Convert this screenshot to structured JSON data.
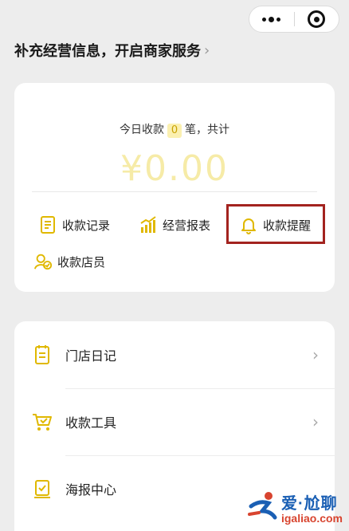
{
  "merchant_banner": {
    "text": "补充经营信息，开启商家服务",
    "chevron": "›"
  },
  "capsule": {
    "more_icon": "more-dots-icon",
    "close_icon": "target-close-icon"
  },
  "collect_card": {
    "today_prefix": "今日收款",
    "count": "0",
    "today_suffix": "笔，共计",
    "amount": "¥0.00",
    "actions": [
      {
        "label": "收款记录",
        "icon": "receipt-list-icon"
      },
      {
        "label": "经营报表",
        "icon": "bar-chart-icon"
      },
      {
        "label": "收款提醒",
        "icon": "bell-icon"
      },
      {
        "label": "收款店员",
        "icon": "staff-icon"
      }
    ]
  },
  "menu": [
    {
      "label": "门店日记",
      "icon": "diary-icon",
      "arrow": "›"
    },
    {
      "label": "收款工具",
      "icon": "cart-icon",
      "arrow": "›"
    },
    {
      "label": "海报中心",
      "icon": "poster-icon",
      "arrow": ""
    }
  ],
  "watermark": {
    "cn": "爱·尬聊",
    "en": "igaliao.com"
  },
  "colors": {
    "accent_yellow": "#f5c518",
    "highlight_red": "#a3231f",
    "amount_faded": "#f6eba7"
  }
}
